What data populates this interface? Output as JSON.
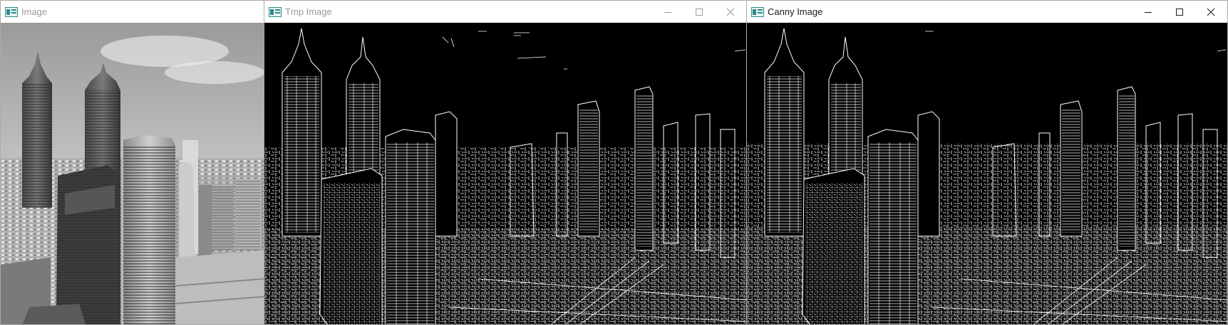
{
  "windows": [
    {
      "title": "Image",
      "state": "inactive",
      "content": "grayscale-photo-city-skyline"
    },
    {
      "title": "Tmp Image",
      "state": "inactive",
      "content": "edge-map-city-skyline"
    },
    {
      "title": "Canny Image",
      "state": "active",
      "content": "edge-map-city-skyline"
    }
  ],
  "window_controls": [
    "minimize-icon",
    "maximize-icon",
    "close-icon"
  ],
  "colors": {
    "titlebar": "#ffffff",
    "title_active": "#1a1a1a",
    "title_inactive": "#9a9a9a",
    "edge_background": "#000000",
    "edge_lines": "#ffffff",
    "app_icon": "#2e8b8b"
  }
}
